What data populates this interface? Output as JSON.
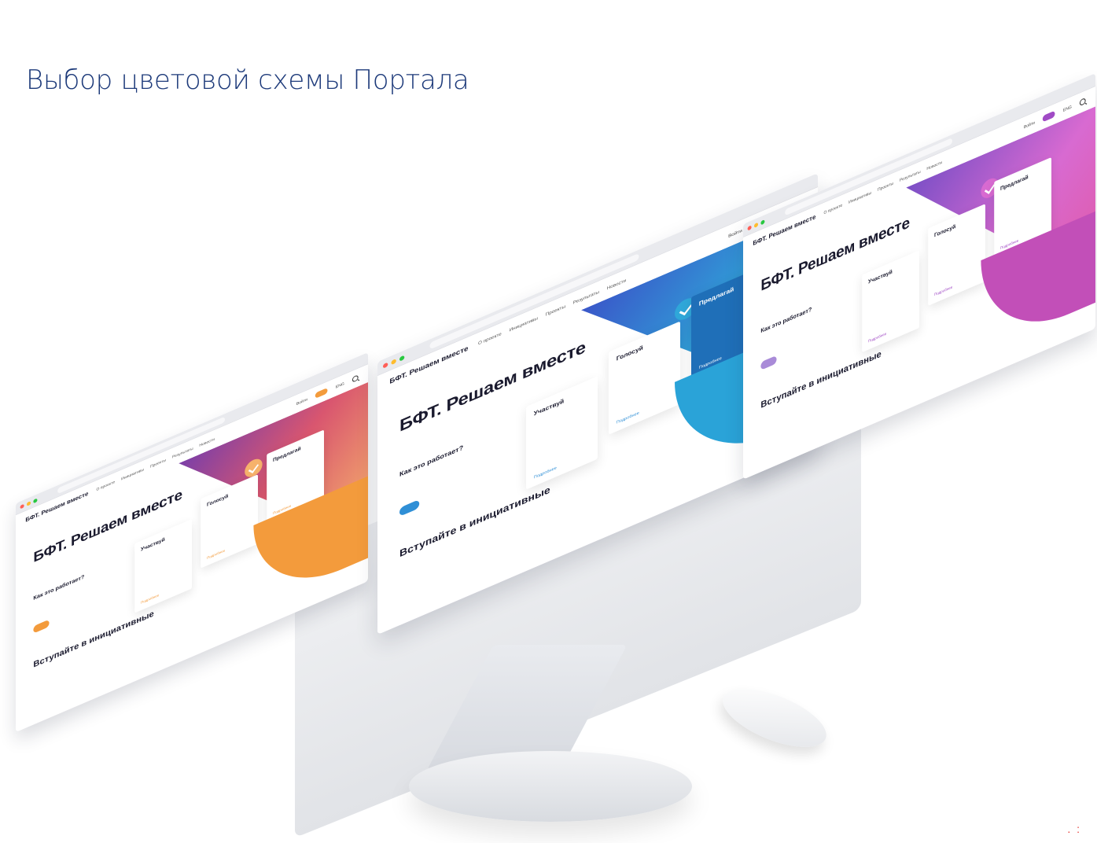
{
  "page": {
    "title": "Выбор цветовой схемы Портала"
  },
  "site": {
    "url": "",
    "logo": "БФТ. Решаем вместе",
    "menu": [
      "О проекте",
      "Инициативы",
      "Проекты",
      "Результаты",
      "Новости"
    ],
    "login": "Войти",
    "cta": "",
    "lang": "ENG",
    "hero_title": "БФТ. Решаем вместе",
    "how": {
      "title": "Как это работает?",
      "text": "",
      "button": ""
    },
    "cards": [
      {
        "title": "Участвуй",
        "text": "",
        "more": "Подробнее"
      },
      {
        "title": "Голосуй",
        "text": "",
        "more": "Подробнее"
      },
      {
        "title": "Предлагай",
        "text": "",
        "more": "Подробнее"
      }
    ],
    "join_title": "Вступайте в инициативные",
    "join_text": ""
  },
  "themes": [
    {
      "name": "orange",
      "accent": "#f39b3c",
      "art": [
        "#f6b26b",
        "#d9566f",
        "#7b3fa8"
      ]
    },
    {
      "name": "blue",
      "accent": "#2f8fd6",
      "art": [
        "#2fa7d9",
        "#3a57c9",
        "#4aa0e8"
      ]
    },
    {
      "name": "purple",
      "accent": "#a04bc5",
      "art": [
        "#d86ad1",
        "#7b4fc6",
        "#e05aa8"
      ]
    }
  ]
}
